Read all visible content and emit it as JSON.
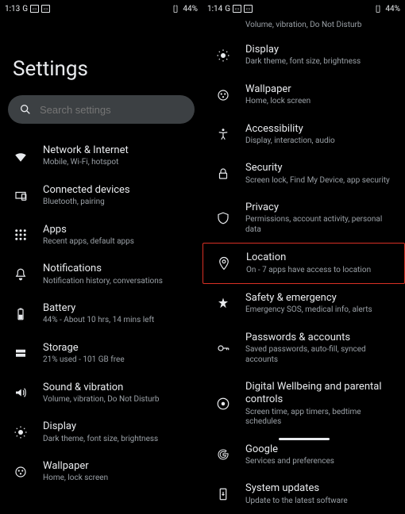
{
  "left": {
    "status": {
      "time": "1:13",
      "carrier_initial": "G",
      "battery": "44%"
    },
    "title": "Settings",
    "search": {
      "placeholder": "Search settings"
    },
    "items": [
      {
        "icon": "wifi-icon",
        "title": "Network & Internet",
        "sub": "Mobile, Wi-Fi, hotspot"
      },
      {
        "icon": "devices-icon",
        "title": "Connected devices",
        "sub": "Bluetooth, pairing"
      },
      {
        "icon": "apps-icon",
        "title": "Apps",
        "sub": "Recent apps, default apps"
      },
      {
        "icon": "notifications-icon",
        "title": "Notifications",
        "sub": "Notification history, conversations"
      },
      {
        "icon": "battery-icon",
        "title": "Battery",
        "sub": "44% - About 10 hrs, 14 mins left"
      },
      {
        "icon": "storage-icon",
        "title": "Storage",
        "sub": "21% used - 101 GB free"
      },
      {
        "icon": "sound-icon",
        "title": "Sound & vibration",
        "sub": "Volume, vibration, Do Not Disturb"
      },
      {
        "icon": "display-icon",
        "title": "Display",
        "sub": "Dark theme, font size, brightness"
      },
      {
        "icon": "wallpaper-icon",
        "title": "Wallpaper",
        "sub": "Home, lock screen"
      }
    ]
  },
  "right": {
    "status": {
      "time": "1:14",
      "carrier_initial": "G",
      "battery": "44%"
    },
    "continuation_sub": "Volume, vibration, Do Not Disturb",
    "items": [
      {
        "icon": "display-icon",
        "title": "Display",
        "sub": "Dark theme, font size, brightness"
      },
      {
        "icon": "wallpaper-icon",
        "title": "Wallpaper",
        "sub": "Home, lock screen"
      },
      {
        "icon": "accessibility-icon",
        "title": "Accessibility",
        "sub": "Display, interaction, audio"
      },
      {
        "icon": "security-icon",
        "title": "Security",
        "sub": "Screen lock, Find My Device, app security"
      },
      {
        "icon": "privacy-icon",
        "title": "Privacy",
        "sub": "Permissions, account activity, personal data"
      },
      {
        "icon": "location-icon",
        "title": "Location",
        "sub": "On - 7 apps have access to location",
        "highlighted": true
      },
      {
        "icon": "emergency-icon",
        "title": "Safety & emergency",
        "sub": "Emergency SOS, medical info, alerts"
      },
      {
        "icon": "passwords-icon",
        "title": "Passwords & accounts",
        "sub": "Saved passwords, auto-fill, synced accounts"
      },
      {
        "icon": "wellbeing-icon",
        "title": "Digital Wellbeing and parental controls",
        "sub": "Screen time, app timers, bedtime schedules"
      },
      {
        "icon": "google-icon",
        "title": "Google",
        "sub": "Services and preferences"
      },
      {
        "icon": "system-update-icon",
        "title": "System updates",
        "sub": "Update to the latest software"
      }
    ]
  }
}
